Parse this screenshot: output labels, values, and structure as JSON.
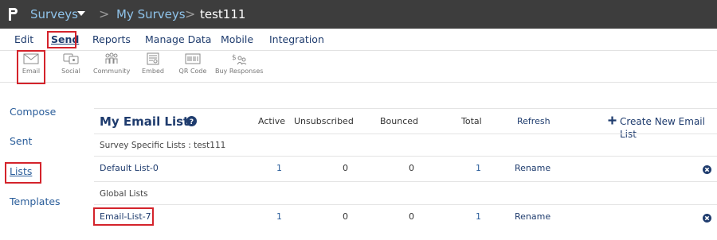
{
  "topbar": {
    "surveys_label": "Surveys",
    "my_surveys_label": "My Surveys",
    "current_label": "test111",
    "separator": ">"
  },
  "menu": {
    "items": [
      "Edit",
      "Send",
      "Reports",
      "Manage Data",
      "Mobile",
      "Integration"
    ],
    "active": "Send"
  },
  "toolbar": {
    "items": [
      {
        "label": "Email",
        "icon": "envelope-icon"
      },
      {
        "label": "Social",
        "icon": "social-icon"
      },
      {
        "label": "Community",
        "icon": "community-icon"
      },
      {
        "label": "Embed",
        "icon": "embed-icon"
      },
      {
        "label": "QR Code",
        "icon": "qr-code-icon"
      },
      {
        "label": "Buy Responses",
        "icon": "buy-responses-icon"
      }
    ]
  },
  "leftnav": {
    "items": [
      "Compose",
      "Sent",
      "Lists",
      "Templates"
    ],
    "active": "Lists"
  },
  "email_lists": {
    "title": "My Email Lists",
    "columns": {
      "active": "Active",
      "unsubscribed": "Unsubscribed",
      "bounced": "Bounced",
      "total": "Total",
      "refresh": "Refresh"
    },
    "create_label": "Create New Email List",
    "survey_specific_label": "Survey Specific Lists : test111",
    "global_label": "Global Lists",
    "rows": [
      {
        "name": "Default List-0",
        "active": "1",
        "unsubscribed": "0",
        "bounced": "0",
        "total": "1",
        "action": "Rename"
      },
      {
        "name": "Email-List-7",
        "active": "1",
        "unsubscribed": "0",
        "bounced": "0",
        "total": "1",
        "action": "Rename"
      }
    ]
  },
  "colors": {
    "topbar_bg": "#3d3d3d",
    "link_blue": "#2a5d9a",
    "navy": "#1f3c6e",
    "highlight_red": "#d4232b"
  }
}
